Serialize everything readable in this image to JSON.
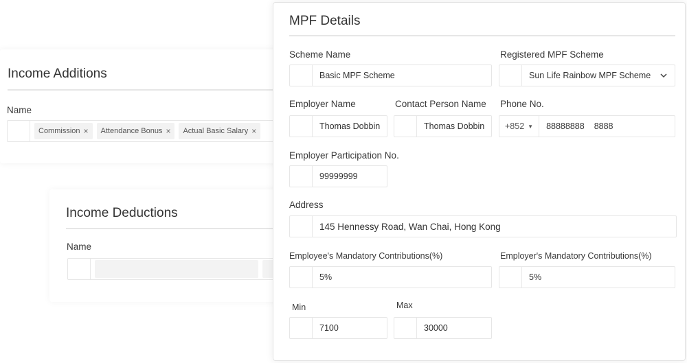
{
  "income_additions": {
    "title": "Income Additions",
    "name_label": "Name",
    "tags": [
      "Commission",
      "Attendance Bonus",
      "Actual Basic Salary"
    ]
  },
  "income_deductions": {
    "title": "Income Deductions",
    "name_label": "Name"
  },
  "mpf": {
    "title": "MPF Details",
    "scheme_name": {
      "label": "Scheme Name",
      "value": "Basic MPF Scheme"
    },
    "registered_scheme": {
      "label": "Registered MPF Scheme",
      "value": "Sun Life Rainbow MPF Scheme"
    },
    "employer_name": {
      "label": "Employer Name",
      "value": "Thomas Dobbin"
    },
    "contact_person": {
      "label": "Contact Person Name",
      "value": "Thomas Dobbin"
    },
    "phone": {
      "label": "Phone No.",
      "code": "+852",
      "number": "88888888",
      "extension": "8888"
    },
    "participation_no": {
      "label": "Employer Participation No.",
      "value": "99999999"
    },
    "address": {
      "label": "Address",
      "value": "145 Hennessy Road, Wan Chai, Hong Kong"
    },
    "employee_mandatory": {
      "label": "Employee's Mandatory Contributions(%)",
      "value": "5%"
    },
    "employer_mandatory": {
      "label": "Employer's Mandatory Contributions(%)",
      "value": "5%"
    },
    "min": {
      "label": "Min",
      "value": "7100"
    },
    "max": {
      "label": "Max",
      "value": "30000"
    }
  }
}
